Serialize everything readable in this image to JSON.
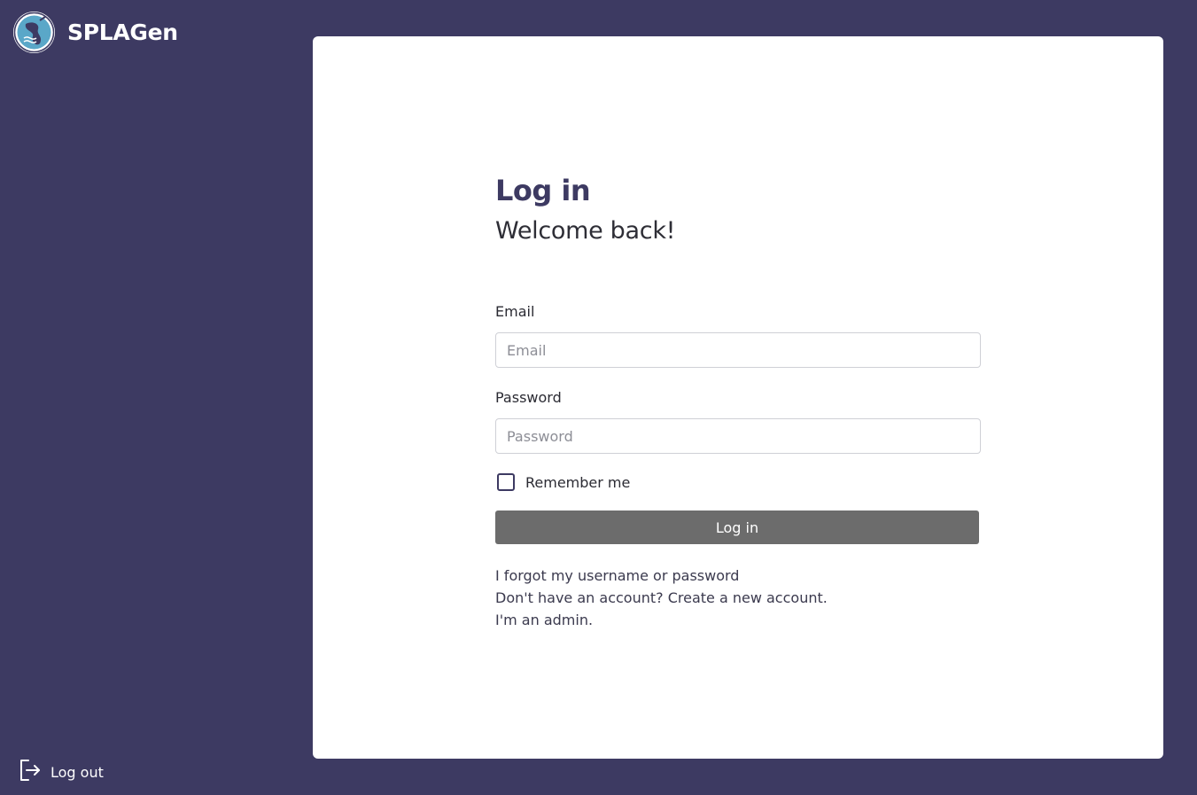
{
  "brand": {
    "name": "SPLAGen"
  },
  "sidebar": {
    "logout_label": "Log out"
  },
  "login": {
    "title": "Log in",
    "subtitle": "Welcome back!",
    "email_label": "Email",
    "email_placeholder": "Email",
    "email_value": "",
    "password_label": "Password",
    "password_placeholder": "Password",
    "password_value": "",
    "remember_label": "Remember me",
    "remember_checked": false,
    "submit_label": "Log in",
    "forgot_link": "I forgot my username or password",
    "register_link": "Don't have an account? Create a new account.",
    "admin_link": "I'm an admin."
  },
  "colors": {
    "background": "#3d3a62",
    "card": "#ffffff",
    "title": "#3d3a62",
    "button": "#6c6c6c"
  },
  "icons": {
    "logo": "splagen-logo-icon",
    "logout": "logout-icon"
  }
}
